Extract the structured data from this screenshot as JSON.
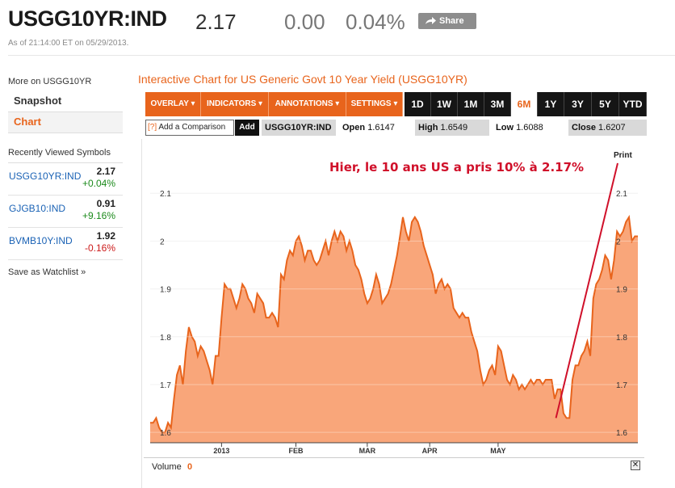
{
  "header": {
    "ticker": "USGG10YR:IND",
    "price": "2.17",
    "change": "0.00",
    "change_pct": "0.04%",
    "share_label": "Share",
    "as_of": "As of 21:14:00 ET on 05/29/2013."
  },
  "sidebar": {
    "more_on": "More on USGG10YR",
    "nav": [
      {
        "label": "Snapshot"
      },
      {
        "label": "Chart"
      }
    ],
    "recent_heading": "Recently Viewed Symbols",
    "recent": [
      {
        "symbol": "USGG10YR:IND",
        "value": "2.17",
        "change": "+0.04%"
      },
      {
        "symbol": "GJGB10:IND",
        "value": "0.91",
        "change": "+9.16%"
      },
      {
        "symbol": "BVMB10Y:IND",
        "value": "1.92",
        "change": "-0.16%"
      }
    ],
    "watchlist": "Save as Watchlist »"
  },
  "chart_panel": {
    "title": "Interactive Chart for US Generic Govt 10 Year Yield (USGG10YR)",
    "menus": [
      "OVERLAY ▾",
      "INDICATORS ▾",
      "ANNOTATIONS ▾",
      "SETTINGS ▾"
    ],
    "ranges": [
      "1D",
      "1W",
      "1M",
      "3M",
      "6M",
      "1Y",
      "3Y",
      "5Y",
      "YTD"
    ],
    "active_range": "6M",
    "compare_q": "[?]",
    "compare_label": "Add a Comparison",
    "add_label": "Add",
    "symbol": "USGG10YR:IND",
    "open_label": "Open",
    "open_value": "1.6147",
    "high_label": "High",
    "high_value": "1.6549",
    "low_label": "Low",
    "low_value": "1.6088",
    "close_label": "Close",
    "close_value": "1.6207",
    "volume_label": "Volume",
    "volume_value": "0",
    "close_icon": "✕"
  },
  "colors": {
    "accent": "#e8641c",
    "area_fill": "#f9a67a",
    "line": "#e8641c",
    "annotation": "#d0102a"
  },
  "chart_data": {
    "type": "area",
    "ylim": [
      1.58,
      2.2
    ],
    "yticks": [
      "1.6",
      "1.7",
      "1.8",
      "1.9",
      "2",
      "2.1"
    ],
    "ytick_values": [
      1.6,
      1.7,
      1.8,
      1.9,
      2.0,
      2.1
    ],
    "xticks": [
      "2013",
      "FEB",
      "MAR",
      "APR",
      "MAY"
    ],
    "xtick_index": [
      24,
      49,
      73,
      94,
      117
    ],
    "values": [
      1.62,
      1.62,
      1.63,
      1.61,
      1.6,
      1.6,
      1.62,
      1.61,
      1.67,
      1.72,
      1.74,
      1.7,
      1.77,
      1.82,
      1.8,
      1.79,
      1.76,
      1.78,
      1.77,
      1.75,
      1.73,
      1.7,
      1.76,
      1.76,
      1.84,
      1.91,
      1.9,
      1.9,
      1.88,
      1.86,
      1.88,
      1.91,
      1.9,
      1.88,
      1.87,
      1.85,
      1.89,
      1.88,
      1.87,
      1.84,
      1.84,
      1.85,
      1.84,
      1.82,
      1.93,
      1.92,
      1.96,
      1.98,
      1.97,
      2.0,
      2.01,
      1.99,
      1.96,
      1.98,
      1.98,
      1.96,
      1.95,
      1.96,
      1.98,
      2.0,
      1.97,
      2.0,
      2.02,
      2.0,
      2.02,
      2.01,
      1.98,
      2.0,
      1.98,
      1.95,
      1.94,
      1.92,
      1.89,
      1.87,
      1.88,
      1.9,
      1.93,
      1.91,
      1.87,
      1.88,
      1.89,
      1.91,
      1.94,
      1.97,
      2.01,
      2.05,
      2.02,
      2.0,
      2.04,
      2.05,
      2.04,
      2.02,
      1.99,
      1.97,
      1.95,
      1.93,
      1.89,
      1.91,
      1.92,
      1.9,
      1.91,
      1.9,
      1.86,
      1.85,
      1.84,
      1.85,
      1.84,
      1.84,
      1.81,
      1.79,
      1.77,
      1.73,
      1.7,
      1.71,
      1.73,
      1.74,
      1.72,
      1.78,
      1.77,
      1.74,
      1.71,
      1.7,
      1.72,
      1.71,
      1.69,
      1.7,
      1.69,
      1.7,
      1.71,
      1.7,
      1.71,
      1.71,
      1.7,
      1.71,
      1.71,
      1.71,
      1.67,
      1.69,
      1.69,
      1.64,
      1.63,
      1.63,
      1.71,
      1.74,
      1.74,
      1.76,
      1.77,
      1.79,
      1.76,
      1.88,
      1.91,
      1.92,
      1.94,
      1.97,
      1.96,
      1.92,
      1.96,
      2.02,
      2.01,
      2.02,
      2.04,
      2.05,
      2.0,
      2.01,
      2.01
    ],
    "print_label": "Print",
    "annotation_text": "Hier, le 10 ans US a pris 10% à 2.17%"
  }
}
